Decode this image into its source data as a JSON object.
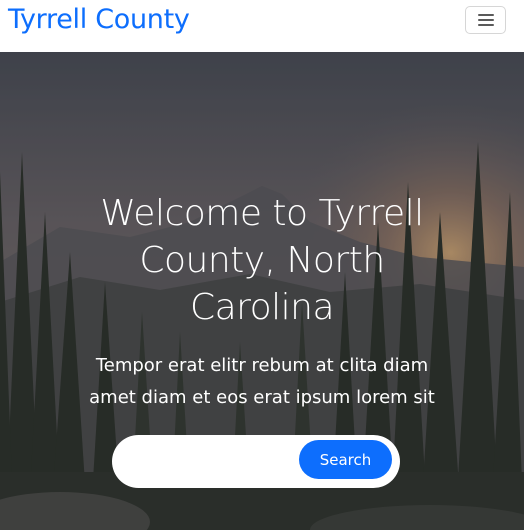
{
  "navbar": {
    "brand": "Tyrrell County",
    "toggler_icon": "hamburger-menu-icon",
    "brand_color": "#0d6efd"
  },
  "hero": {
    "title": "Welcome to Tyrrell County, North Carolina",
    "subtitle": "Tempor erat elitr rebum at clita diam amet diam et eos erat ipsum lorem sit",
    "background": "forest-mountain-sunset-image"
  },
  "search": {
    "input_value": "",
    "button_label": "Search",
    "button_color": "#0d6efd"
  }
}
